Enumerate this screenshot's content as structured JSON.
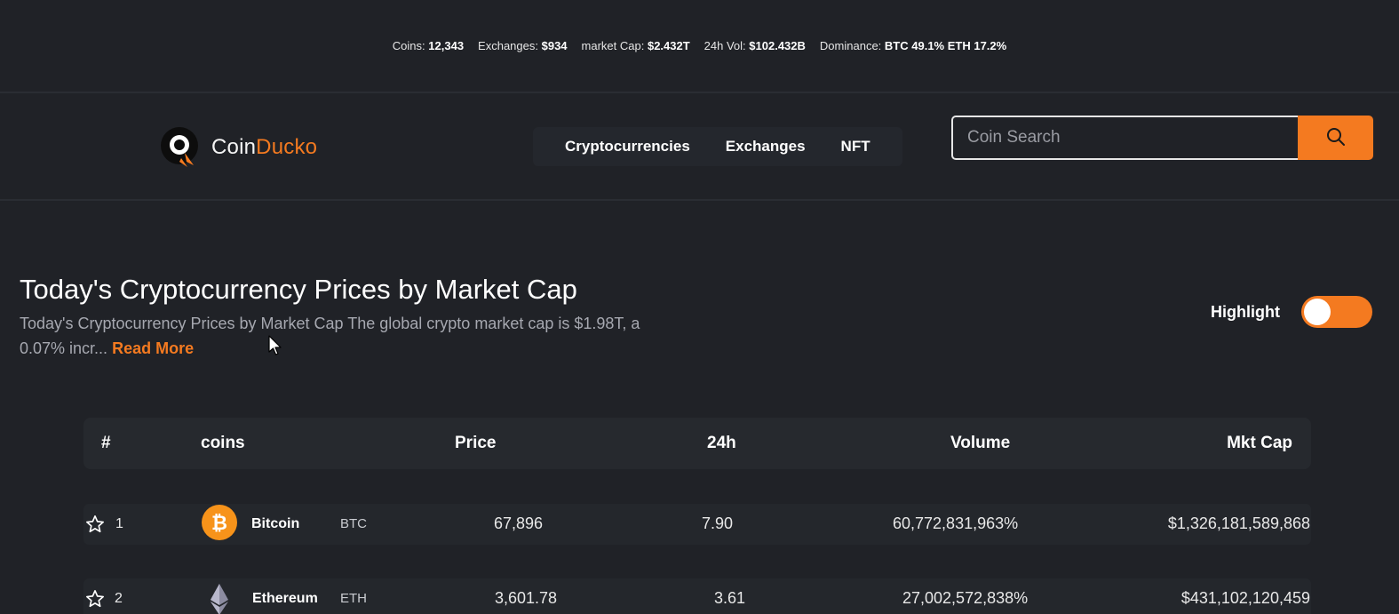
{
  "stats": {
    "coins_label": "Coins:",
    "coins_value": "12,343",
    "exchanges_label": "Exchanges:",
    "exchanges_value": "$934",
    "marketcap_label": "market Cap:",
    "marketcap_value": "$2.432T",
    "vol_label": "24h Vol:",
    "vol_value": "$102.432B",
    "dominance_label": "Dominance:",
    "dominance_value": "BTC 49.1% ETH 17.2%"
  },
  "logo": {
    "text_main": "Coin",
    "text_accent": "Ducko"
  },
  "nav": {
    "items": [
      "Cryptocurrencies",
      "Exchanges",
      "NFT"
    ]
  },
  "search": {
    "placeholder": "Coin Search",
    "icon": "search-icon"
  },
  "page": {
    "title": "Today's Cryptocurrency Prices by Market Cap",
    "description": "Today's Cryptocurrency Prices by Market Cap The global crypto market cap is $1.98T, a 0.07% incr...",
    "read_more": "Read More"
  },
  "highlight": {
    "label": "Highlight",
    "enabled": true
  },
  "table": {
    "headers": {
      "rank": "#",
      "coins": "coins",
      "price": "Price",
      "change": "24h",
      "volume": "Volume",
      "mktcap": "Mkt Cap"
    },
    "rows": [
      {
        "rank": "1",
        "name": "Bitcoin",
        "symbol": "BTC",
        "price": "67,896",
        "change": "7.90",
        "volume": "60,772,831,963%",
        "mktcap": "$1,326,181,589,868",
        "icon": "bitcoin-icon"
      },
      {
        "rank": "2",
        "name": "Ethereum",
        "symbol": "ETH",
        "price": "3,601.78",
        "change": "3.61",
        "volume": "27,002,572,838%",
        "mktcap": "$431,102,120,459",
        "icon": "ethereum-icon"
      }
    ]
  },
  "colors": {
    "accent": "#f47a20",
    "background": "#202227",
    "row": "#24272c"
  }
}
